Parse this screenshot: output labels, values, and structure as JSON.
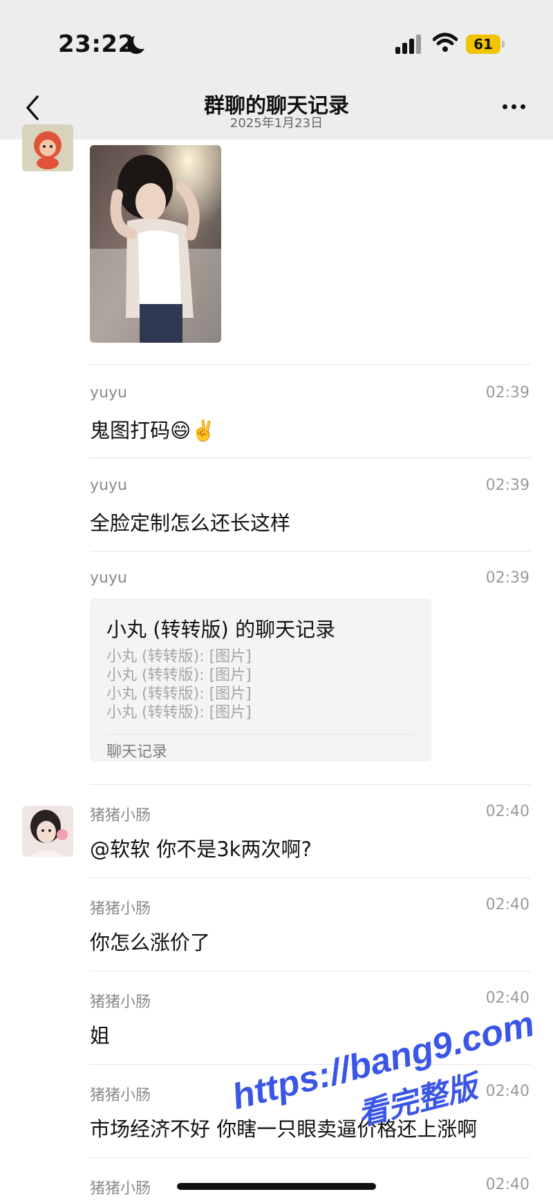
{
  "status_bar": {
    "time": "23:22",
    "battery": "61",
    "moon_icon": "moon-icon",
    "signal_icon": "signal-icon",
    "wifi_icon": "wifi-icon"
  },
  "nav": {
    "title": "群聊的聊天记录",
    "subtitle": "2025年1月23日",
    "back_icon": "chevron-left-icon",
    "more_icon": "ellipsis-icon"
  },
  "messages": [
    {
      "name": "yuyu",
      "time": "02:39",
      "text": "鬼图打码😄✌️"
    },
    {
      "name": "yuyu",
      "time": "02:39",
      "text": "全脸定制怎么还长这样"
    },
    {
      "name": "yuyu",
      "time": "02:39",
      "card": {
        "title": "小丸 (转转版) 的聊天记录",
        "lines": [
          "小丸 (转转版): [图片]",
          "小丸 (转转版): [图片]",
          "小丸 (转转版): [图片]",
          "小丸 (转转版): [图片]"
        ],
        "footer": "聊天记录"
      }
    },
    {
      "name": "猪猪小肠",
      "time": "02:40",
      "text": "@软软 你不是3k两次啊?"
    },
    {
      "name": "猪猪小肠",
      "time": "02:40",
      "text": "你怎么涨价了"
    },
    {
      "name": "猪猪小肠",
      "time": "02:40",
      "text": "姐"
    },
    {
      "name": "猪猪小肠",
      "time": "02:40",
      "text": "市场经济不好 你瞎一只眼卖逼价格还上涨啊"
    },
    {
      "name": "猪猪小肠",
      "time": "02:40",
      "text": ""
    }
  ],
  "watermark": {
    "url": "https://bang9.com",
    "caption": "看完整版"
  },
  "colors": {
    "header_bg": "#ededed",
    "battery": "#f2c400",
    "watermark": "#3b56e6"
  }
}
